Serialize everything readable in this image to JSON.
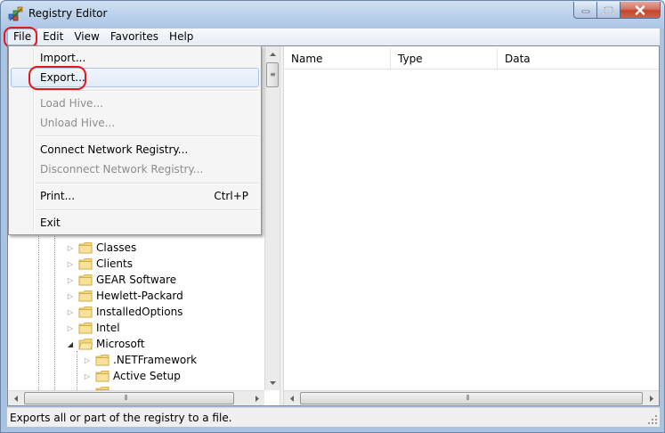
{
  "window": {
    "title": "Registry Editor",
    "icon": "registry-editor-icon"
  },
  "menubar": {
    "items": [
      {
        "label": "File",
        "active": true
      },
      {
        "label": "Edit"
      },
      {
        "label": "View"
      },
      {
        "label": "Favorites"
      },
      {
        "label": "Help"
      }
    ]
  },
  "file_menu": {
    "items": [
      {
        "label": "Import...",
        "enabled": true
      },
      {
        "label": "Export...",
        "enabled": true,
        "highlighted": true
      },
      {
        "label": "Load Hive...",
        "enabled": false
      },
      {
        "label": "Unload Hive...",
        "enabled": false
      },
      {
        "label": "Connect Network Registry...",
        "enabled": true
      },
      {
        "label": "Disconnect Network Registry...",
        "enabled": false
      },
      {
        "label": "Print...",
        "enabled": true,
        "shortcut": "Ctrl+P"
      },
      {
        "label": "Exit",
        "enabled": true
      }
    ]
  },
  "tree": {
    "nodes": [
      {
        "label": "Classes",
        "expanded": false,
        "level": 1
      },
      {
        "label": "Clients",
        "expanded": false,
        "level": 1
      },
      {
        "label": "GEAR Software",
        "expanded": false,
        "level": 1
      },
      {
        "label": "Hewlett-Packard",
        "expanded": false,
        "level": 1
      },
      {
        "label": "InstalledOptions",
        "expanded": false,
        "level": 1
      },
      {
        "label": "Intel",
        "expanded": false,
        "level": 1
      },
      {
        "label": "Microsoft",
        "expanded": true,
        "level": 1
      },
      {
        "label": ".NETFramework",
        "expanded": false,
        "level": 2
      },
      {
        "label": "Active Setup",
        "expanded": false,
        "level": 2
      }
    ]
  },
  "list": {
    "columns": [
      "Name",
      "Type",
      "Data"
    ]
  },
  "statusbar": {
    "text": "Exports all or part of the registry to a file."
  },
  "colors": {
    "highlight_outline": "#e01b1b",
    "title_bar": "#b8cfe9"
  }
}
